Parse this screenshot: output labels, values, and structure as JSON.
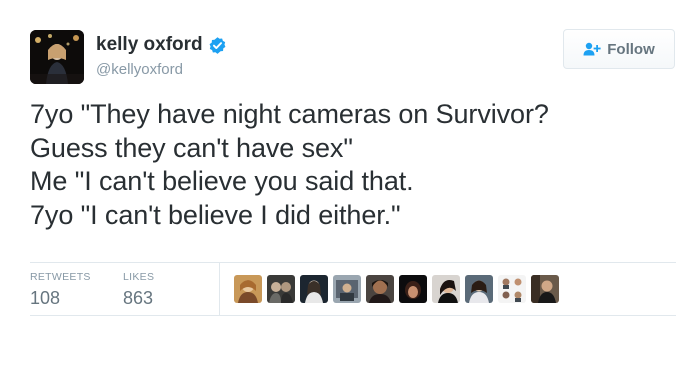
{
  "user": {
    "name": "kelly oxford",
    "handle": "@kellyoxford"
  },
  "follow_button": {
    "label": "Follow"
  },
  "tweet": {
    "lines": [
      "7yo \"They have night cameras on Survivor?",
      "Guess they can't have sex\"",
      "Me \"I can't believe you said that.",
      "7yo \"I can't believe I did either.\""
    ]
  },
  "stats": {
    "retweets_label": "RETWEETS",
    "retweets_value": "108",
    "likes_label": "LIKES",
    "likes_value": "863"
  },
  "icons": {
    "verified": "verified-badge-icon",
    "follow": "add-user-icon"
  },
  "colors": {
    "verified": "#1da1f2",
    "text": "#292f33",
    "muted": "#8899a6"
  }
}
